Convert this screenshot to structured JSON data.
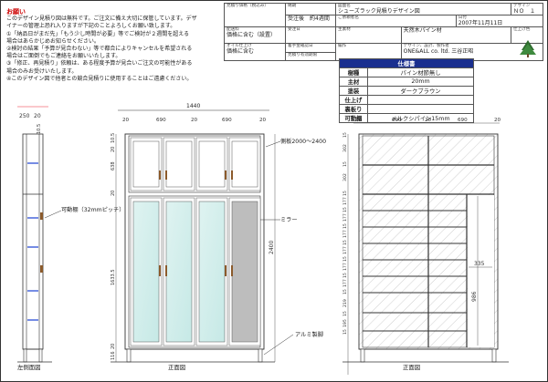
{
  "notice": {
    "heading": "お願い",
    "lines": [
      "このデザイン見積り図は無料です。ご注文に備え大切に保管しています。デザ",
      "イナーの管理上恐れ入りますが下記のことよろしくお願い致します。",
      "①「納品日がまだ先」「もう少し時間が必要」等でご検討が２週間を超える",
      "場合はあらかじめお知らせください。",
      "②検討の結果「予算が見合わない」等で都合によりキャンセルを希望される",
      "場合はご面倒でもご連絡をお願いいたします。",
      "③「修正、再見積り」依頼は、ある程度予算が見合いご注文の可能性がある",
      "場合のみお受けいたします。",
      "④このデザイン図で他者との競合見積りに使用することはご遠慮ください。"
    ]
  },
  "info": {
    "quote_price_label": "見積り価格（税込み）",
    "delivery_cost_label": "配送料",
    "delivery_cost_value": "価格に含む（設置）",
    "oil_finish_label": "オイル仕上げ",
    "oil_finish_value": "価格に含む",
    "delivery_label": "納期",
    "delivery_value": "受注後　約4週間",
    "order_date_label": "受注日",
    "deposit_label": "着手金確認日",
    "valid_label": "見積り有効期限",
    "drawing_name_label": "図面名",
    "drawing_name_value": "シューズラック見積りデザイン図",
    "design_no_label": "デザイン",
    "design_no_value": "ＮＯ　１",
    "customer_label": "ご依頼者名",
    "date_label": "日付",
    "date_value": "2007年11月11日",
    "material_label": "主素材",
    "material_value": "天然木パイン材",
    "finish_label": "仕上げ色",
    "production_label": "編作",
    "producer_label": "デザイン、設計、製作者",
    "producer_value": "ONE&ALL co. ltd.  三谷正昭"
  },
  "spec": {
    "title": "仕様書",
    "rows": [
      {
        "k": "樹種",
        "v": "パイン材節無し"
      },
      {
        "k": "主材",
        "v": "20mm"
      },
      {
        "k": "塗装",
        "v": "ダークブラウン"
      },
      {
        "k": "仕上げ",
        "v": ""
      },
      {
        "k": "裏板り",
        "v": ""
      },
      {
        "k": "可動棚",
        "v": "メルクシパイン15mm"
      }
    ]
  },
  "drawing": {
    "side_label": "左側面図",
    "front_label": "正面図",
    "front_inside_label": "正面図",
    "shelf_note": "可動棚（32mmピッチ）",
    "side_panel_note": "側板2000～2400",
    "mirror_note": "ミラー",
    "aluminum_note": "アルミ製脚",
    "side_dims": [
      "250",
      "20",
      "10.5"
    ],
    "front_top": [
      "20",
      "690",
      "20",
      "690",
      "20"
    ],
    "front_width": "1440",
    "front_heights": [
      "10.5",
      "20",
      "638",
      "20",
      "1633.5",
      "20",
      "116"
    ],
    "front_height_total": "2400",
    "inner_top": [
      "20",
      "690",
      "20",
      "690",
      "20"
    ],
    "inner_heights": [
      "15",
      "302",
      "15",
      "302",
      "15",
      "177",
      "15",
      "177",
      "15",
      "177",
      "15",
      "177",
      "15",
      "177",
      "15",
      "177",
      "15",
      "219",
      "15",
      "195",
      "15"
    ],
    "inner_dim_335": "335",
    "inner_dim_986": "986"
  }
}
